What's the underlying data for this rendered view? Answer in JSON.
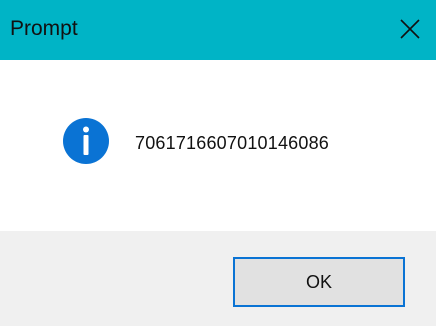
{
  "window": {
    "title": "Prompt",
    "titlebar_color": "#00b4c6"
  },
  "titlebar": {
    "close_icon": "close-icon"
  },
  "content": {
    "icon": "info-icon",
    "icon_color": "#0a73d4",
    "message": "7061716607010146086"
  },
  "footer": {
    "ok_label": "OK",
    "ok_border_color": "#0a73d4"
  }
}
